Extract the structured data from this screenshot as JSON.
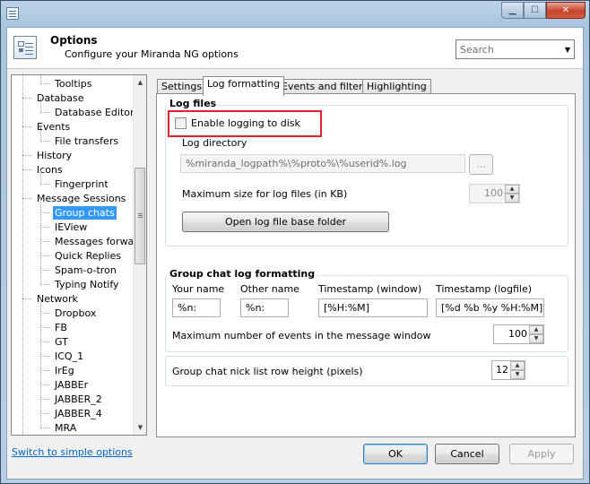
{
  "window": {
    "title": "Options",
    "subtitle": "Configure your Miranda NG options",
    "controls": [
      "minimize",
      "maximize",
      "close"
    ]
  },
  "search": {
    "placeholder": "Search"
  },
  "tree": {
    "items": [
      {
        "label": "Tooltips",
        "level": 2
      },
      {
        "label": "Database",
        "level": 1
      },
      {
        "label": "Database Editor++",
        "level": 2
      },
      {
        "label": "Events",
        "level": 1
      },
      {
        "label": "File transfers",
        "level": 2
      },
      {
        "label": "History",
        "level": 1
      },
      {
        "label": "Icons",
        "level": 1
      },
      {
        "label": "Fingerprint",
        "level": 2
      },
      {
        "label": "Message Sessions",
        "level": 1
      },
      {
        "label": "Group chats",
        "level": 2,
        "selected": true
      },
      {
        "label": "IEView",
        "level": 2
      },
      {
        "label": "Messages forwarding",
        "level": 2
      },
      {
        "label": "Quick Replies",
        "level": 2
      },
      {
        "label": "Spam-o-tron",
        "level": 2
      },
      {
        "label": "Typing Notify",
        "level": 2
      },
      {
        "label": "Network",
        "level": 1
      },
      {
        "label": "Dropbox",
        "level": 2
      },
      {
        "label": "FB",
        "level": 2
      },
      {
        "label": "GT",
        "level": 2
      },
      {
        "label": "ICQ_1",
        "level": 2
      },
      {
        "label": "IrEg",
        "level": 2
      },
      {
        "label": "JABBEr",
        "level": 2
      },
      {
        "label": "JABBER_2",
        "level": 2
      },
      {
        "label": "JABBER_4",
        "level": 2
      },
      {
        "label": "MRA",
        "level": 2
      }
    ]
  },
  "tabs": [
    {
      "label": "Settings",
      "active": false
    },
    {
      "label": "Log formatting",
      "active": true
    },
    {
      "label": "Events and filters",
      "active": false
    },
    {
      "label": "Highlighting",
      "active": false
    }
  ],
  "log_files": {
    "group_title": "Log files",
    "enable_logging_label": "Enable logging to disk",
    "enable_logging_checked": false,
    "log_directory_label": "Log directory",
    "log_directory_value": "%miranda_logpath%\\%proto%\\%userid%.log",
    "browse_label": "...",
    "max_size_label": "Maximum size for log files (in KB)",
    "max_size_value": "100",
    "open_folder_label": "Open log file base folder"
  },
  "group_chat": {
    "group_title": "Group chat log formatting",
    "your_name_label": "Your name",
    "your_name_value": "%n:",
    "other_name_label": "Other name",
    "other_name_value": "%n:",
    "ts_window_label": "Timestamp (window)",
    "ts_window_value": "[%H:%M]",
    "ts_logfile_label": "Timestamp (logfile)",
    "ts_logfile_value": "[%d %b %y %H:%M]",
    "max_events_label": "Maximum number of events in the message window",
    "max_events_value": "100"
  },
  "nick_list": {
    "row_height_label": "Group chat nick list row height (pixels)",
    "row_height_value": "12"
  },
  "footer": {
    "simple_options_link": "Switch to simple options",
    "ok_label": "OK",
    "cancel_label": "Cancel",
    "apply_label": "Apply"
  },
  "colors": {
    "selection": "#3399ff",
    "highlight_box": "#d9232d",
    "link": "#0066cc"
  }
}
